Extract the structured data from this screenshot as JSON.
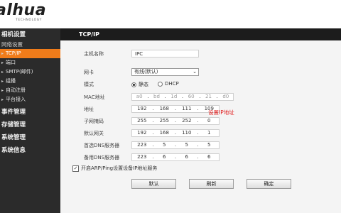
{
  "brand": {
    "logo": "alhua",
    "tagline": "TECHNOLOGY"
  },
  "sidebar": {
    "items": [
      {
        "kind": "cat",
        "label": "相机设置"
      },
      {
        "kind": "sub",
        "label": "网络设置"
      },
      {
        "kind": "item",
        "label": "TCP/IP",
        "active": true
      },
      {
        "kind": "item",
        "label": "端口"
      },
      {
        "kind": "item",
        "label": "SMTP(邮件)"
      },
      {
        "kind": "item",
        "label": "组播"
      },
      {
        "kind": "item",
        "label": "自动注册"
      },
      {
        "kind": "item",
        "label": "平台接入"
      },
      {
        "kind": "cat",
        "label": "事件管理"
      },
      {
        "kind": "cat",
        "label": "存储管理"
      },
      {
        "kind": "cat",
        "label": "系统管理"
      },
      {
        "kind": "cat",
        "label": "系统信息"
      }
    ]
  },
  "tab": {
    "label": "TCP/IP"
  },
  "form": {
    "hostname": {
      "label": "主机名称",
      "value": "IPC"
    },
    "nic": {
      "label": "网卡",
      "value": "有线(默认)"
    },
    "mode": {
      "label": "模式",
      "static": "静态",
      "dhcp": "DHCP",
      "selected": "静态"
    },
    "mac": {
      "label": "MAC地址",
      "octets": [
        "a0",
        "bd",
        "1d",
        "60",
        "21",
        "d0"
      ]
    },
    "address": {
      "label": "地址",
      "octets": [
        "192",
        "168",
        "111",
        "109"
      ]
    },
    "subnet": {
      "label": "子网掩码",
      "octets": [
        "255",
        "255",
        "252",
        "0"
      ]
    },
    "gateway": {
      "label": "默认网关",
      "octets": [
        "192",
        "168",
        "110",
        "1"
      ]
    },
    "dns1": {
      "label": "首选DNS服务器",
      "octets": [
        "223",
        "5",
        "5",
        "5"
      ]
    },
    "dns2": {
      "label": "备用DNS服务器",
      "octets": [
        "223",
        "6",
        "6",
        "6"
      ]
    },
    "arp": {
      "label": "开启ARP/Ping设置设备IP地址服务",
      "checked": true
    }
  },
  "annotation": "设置IP地址",
  "buttons": {
    "default": "默认",
    "refresh": "刷新",
    "ok": "确定"
  },
  "colors": {
    "accent": "#f07c1a",
    "sidebar_bg": "#2b2b2b",
    "annotation": "#e02020"
  }
}
